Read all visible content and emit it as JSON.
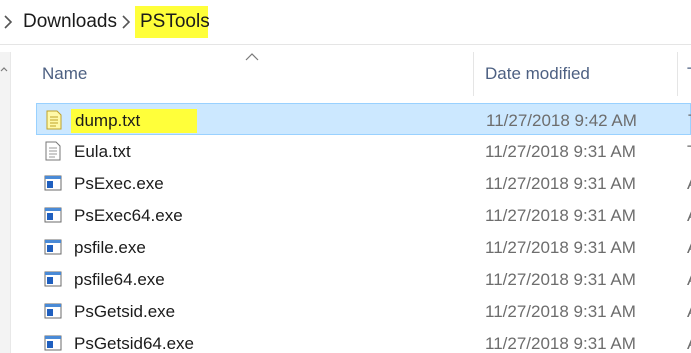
{
  "breadcrumb": [
    {
      "label": "Downloads"
    },
    {
      "label": "PSTools"
    }
  ],
  "columns": {
    "name": "Name",
    "date_modified": "Date modified",
    "type_partial": "T"
  },
  "sort": {
    "column": "name",
    "direction": "ascending"
  },
  "files": [
    {
      "name": "dump.txt",
      "date": "11/27/2018 9:42 AM",
      "icon": "text-file-icon",
      "type_partial": "T",
      "selected": true,
      "highlighted": true
    },
    {
      "name": "Eula.txt",
      "date": "11/27/2018 9:31 AM",
      "icon": "text-file-icon",
      "type_partial": "T",
      "selected": false,
      "highlighted": false
    },
    {
      "name": "PsExec.exe",
      "date": "11/27/2018 9:31 AM",
      "icon": "exe-file-icon",
      "type_partial": "A",
      "selected": false,
      "highlighted": false
    },
    {
      "name": "PsExec64.exe",
      "date": "11/27/2018 9:31 AM",
      "icon": "exe-file-icon",
      "type_partial": "A",
      "selected": false,
      "highlighted": false
    },
    {
      "name": "psfile.exe",
      "date": "11/27/2018 9:31 AM",
      "icon": "exe-file-icon",
      "type_partial": "A",
      "selected": false,
      "highlighted": false
    },
    {
      "name": "psfile64.exe",
      "date": "11/27/2018 9:31 AM",
      "icon": "exe-file-icon",
      "type_partial": "A",
      "selected": false,
      "highlighted": false
    },
    {
      "name": "PsGetsid.exe",
      "date": "11/27/2018 9:31 AM",
      "icon": "exe-file-icon",
      "type_partial": "A",
      "selected": false,
      "highlighted": false
    },
    {
      "name": "PsGetsid64.exe",
      "date": "11/27/2018 9:31 AM",
      "icon": "exe-file-icon",
      "type_partial": "A",
      "selected": false,
      "highlighted": false
    }
  ],
  "colors": {
    "selection": "#cce8ff",
    "selection_border": "#99d1ff",
    "highlight": "#ffff3a",
    "header_text": "#4d6082",
    "date_text": "#6d6d6d"
  }
}
